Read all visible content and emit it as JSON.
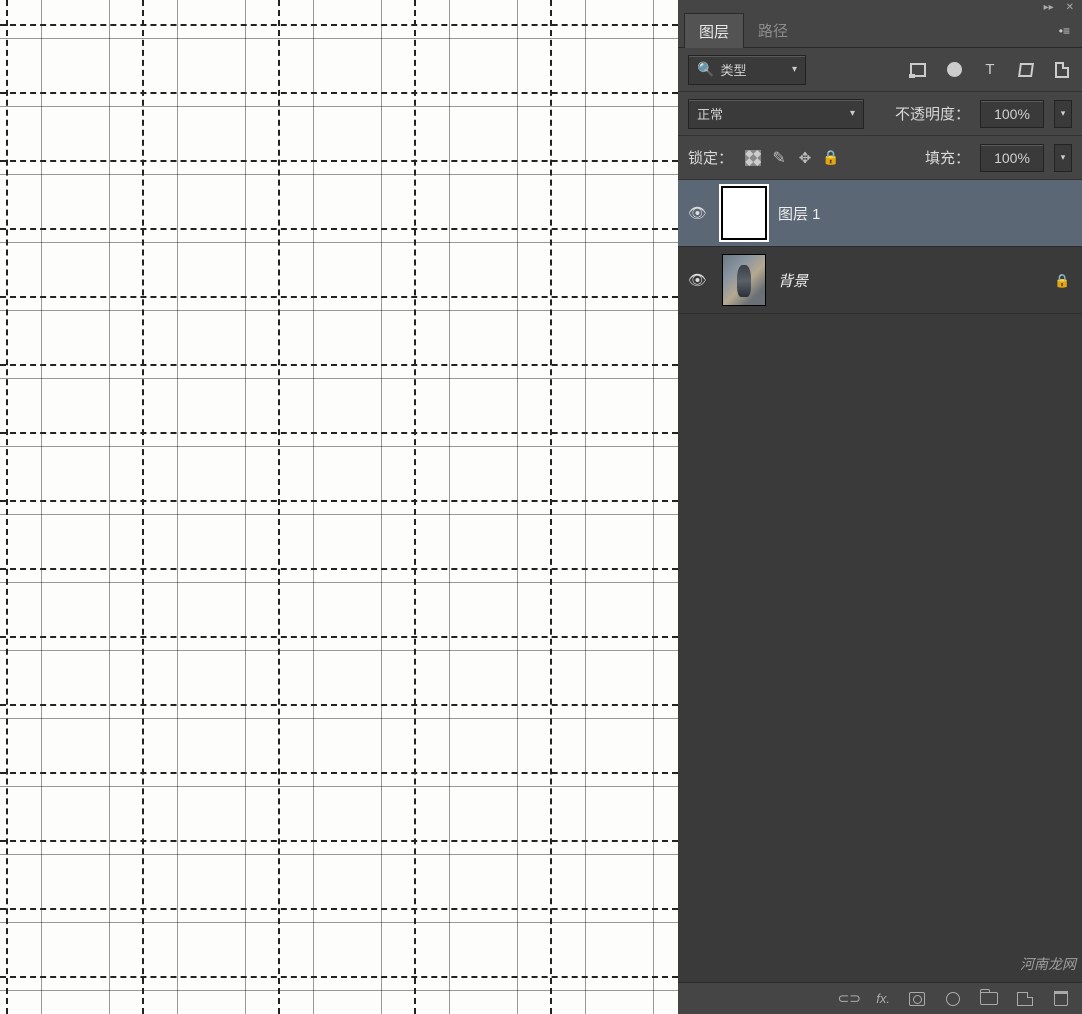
{
  "tabs": {
    "layers": "图层",
    "paths": "路径"
  },
  "filter": {
    "label": "类型"
  },
  "blend": {
    "mode": "正常",
    "opacity_label": "不透明度：",
    "opacity_value": "100%"
  },
  "lock": {
    "label": "锁定：",
    "fill_label": "填充：",
    "fill_value": "100%"
  },
  "layers": [
    {
      "name": "图层 1",
      "selected": true,
      "locked": false
    },
    {
      "name": "背景",
      "selected": false,
      "locked": true
    }
  ],
  "icons": {
    "eye": "👁",
    "arrow": "▾",
    "menu": "▾≡",
    "minimize": "▸▸",
    "close": "✕",
    "lock": "🔒",
    "brush": "✎",
    "move": "✥",
    "fx": "fx.",
    "link": "⊂⊃"
  },
  "watermark": "河南龙网"
}
